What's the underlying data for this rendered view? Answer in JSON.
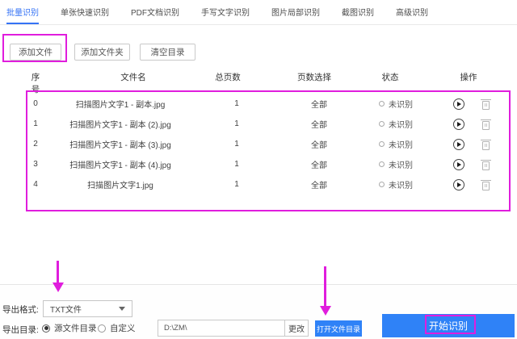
{
  "tabs": [
    {
      "label": "批量识别",
      "active": true
    },
    {
      "label": "单张快速识别",
      "active": false
    },
    {
      "label": "PDF文档识别",
      "active": false
    },
    {
      "label": "手写文字识别",
      "active": false
    },
    {
      "label": "图片局部识别",
      "active": false
    },
    {
      "label": "截图识别",
      "active": false
    },
    {
      "label": "高级识别",
      "active": false
    }
  ],
  "toolbar": {
    "add_file": "添加文件",
    "add_folder": "添加文件夹",
    "clear_list": "清空目录"
  },
  "table": {
    "headers": {
      "index": "序号",
      "filename": "文件名",
      "pages": "总页数",
      "page_select": "页数选择",
      "status": "状态",
      "actions": "操作"
    },
    "rows": [
      {
        "index": "0",
        "filename": "扫描图片文字1 - 副本.jpg",
        "pages": "1",
        "page_select": "全部",
        "status": "未识别"
      },
      {
        "index": "1",
        "filename": "扫描图片文字1 - 副本 (2).jpg",
        "pages": "1",
        "page_select": "全部",
        "status": "未识别"
      },
      {
        "index": "2",
        "filename": "扫描图片文字1 - 副本 (3).jpg",
        "pages": "1",
        "page_select": "全部",
        "status": "未识别"
      },
      {
        "index": "3",
        "filename": "扫描图片文字1 - 副本 (4).jpg",
        "pages": "1",
        "page_select": "全部",
        "status": "未识别"
      },
      {
        "index": "4",
        "filename": "扫描图片文字1.jpg",
        "pages": "1",
        "page_select": "全部",
        "status": "未识别"
      }
    ]
  },
  "footer": {
    "export_format_label": "导出格式:",
    "export_format_value": "TXT文件",
    "export_dir_label": "导出目录:",
    "radio_source_label": "源文件目录",
    "radio_source_selected": true,
    "radio_custom_label": "自定义",
    "radio_custom_selected": false,
    "path_value": "D:\\ZM\\",
    "change_button": "更改",
    "open_dir_button": "打开文件目录",
    "start_button": "开始识别"
  },
  "icons": {
    "row_play": "play-circle",
    "row_delete": "trash",
    "dropdown_caret": "caret-down",
    "status_circle": "circle-outline"
  },
  "colors": {
    "accent_blue": "#2f82f7",
    "tab_active_blue": "#3573f5",
    "annotation_magenta": "#e01ddd"
  }
}
